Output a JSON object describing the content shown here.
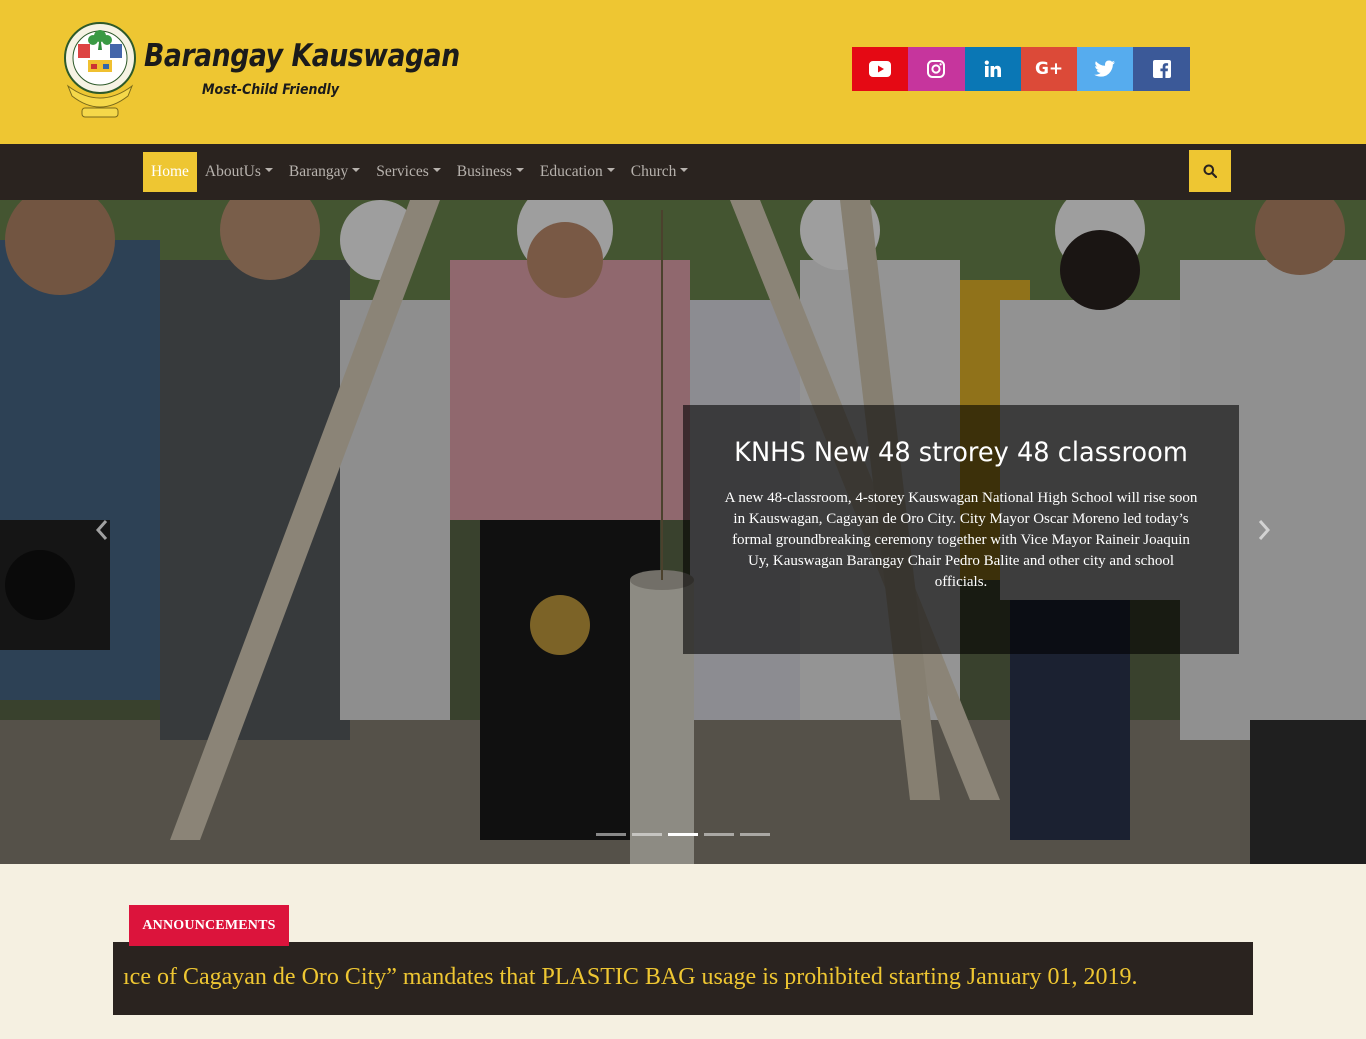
{
  "header": {
    "brand_name": "Barangay Kauswagan",
    "tagline": "Most-Child Friendly",
    "social": [
      {
        "name": "youtube",
        "icon": "youtube-icon",
        "color": "#e50914"
      },
      {
        "name": "instagram",
        "icon": "instagram-icon",
        "color": "#c6359d"
      },
      {
        "name": "linkedin",
        "icon": "linkedin-icon",
        "color": "#0a77b5"
      },
      {
        "name": "google-plus",
        "icon": "google-plus-icon",
        "label": "G+",
        "color": "#dc4a38"
      },
      {
        "name": "twitter",
        "icon": "twitter-icon",
        "color": "#56acee"
      },
      {
        "name": "facebook",
        "icon": "facebook-icon",
        "color": "#3b5998"
      }
    ]
  },
  "nav": {
    "items": [
      {
        "label": "Home",
        "active": true
      },
      {
        "label": "AboutUs",
        "dropdown": true
      },
      {
        "label": "Barangay",
        "dropdown": true
      },
      {
        "label": "Services",
        "dropdown": true
      },
      {
        "label": "Business",
        "dropdown": true
      },
      {
        "label": "Education",
        "dropdown": true
      },
      {
        "label": "Church",
        "dropdown": true
      }
    ],
    "search_icon": "search-icon"
  },
  "carousel": {
    "caption_title": "KNHS New 48 strorey 48 classroom",
    "caption_text": "A new 48-classroom, 4-storey Kauswagan National High School will rise soon in Kauswagan, Cagayan de Oro City. City Mayor Oscar Moreno led today’s formal groundbreaking ceremony together with Vice Mayor Raineir Joaquin Uy, Kauswagan Barangay Chair Pedro Balite and other city and school officials.",
    "slide_count": 5,
    "active_slide": 3,
    "prev_icon": "chevron-left-icon",
    "next_icon": "chevron-right-icon"
  },
  "announcements": {
    "label": "ANNOUNCEMENTS",
    "ticker_text": "ıce of Cagayan de Oro City” mandates that PLASTIC BAG usage is prohibited starting January 01, 2019."
  },
  "colors": {
    "brand_yellow": "#eec632",
    "nav_dark": "#2a231f",
    "announcement_red": "#dc143c",
    "page_bg": "#f5f0e1"
  }
}
